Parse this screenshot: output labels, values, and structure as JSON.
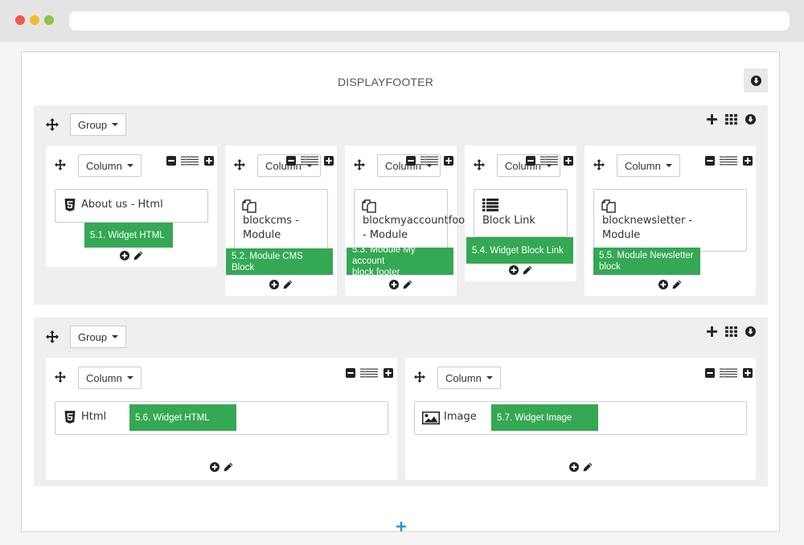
{
  "hook": {
    "title": "DISPLAYFOOTER"
  },
  "icons": {
    "move": "move-arrows-icon",
    "add": "plus-icon",
    "grid": "grid-icon",
    "arrow_down": "arrow-down-circle-icon",
    "minus": "minus-square-icon",
    "width": "width-lines-icon",
    "plus_square": "plus-square-icon",
    "html5": "html5-icon",
    "module": "module-copy-icon",
    "list": "list-icon",
    "image": "image-icon",
    "edit": "pencil-icon"
  },
  "colors": {
    "callout": "#34a853",
    "accent_plus": "#1a9ed4"
  },
  "groups": [
    {
      "label": "Group",
      "columns": [
        {
          "label": "Column",
          "widget": {
            "title": "About us - Html",
            "icon": "html5-icon"
          },
          "note": "5.1. Widget HTML"
        },
        {
          "label": "Column",
          "widget": {
            "title": "blockcms -",
            "subtitle": "Module",
            "icon": "module-copy-icon"
          },
          "note": "5.2. Module CMS Block"
        },
        {
          "label": "Column",
          "widget": {
            "title": "blockmyaccountfoo",
            "subtitle": "- Module",
            "icon": "module-copy-icon"
          },
          "note": "5.3. Module My account",
          "note2": "block footer"
        },
        {
          "label": "Column",
          "widget": {
            "title": "Block Link",
            "icon": "list-icon"
          },
          "note": "5.4. Widget Block Link"
        },
        {
          "label": "Column",
          "widget": {
            "title": "blocknewsletter -",
            "subtitle": "Module",
            "icon": "module-copy-icon"
          },
          "note": "5.5. Module Newsletter",
          "note2": "block"
        }
      ]
    },
    {
      "label": "Group",
      "columns": [
        {
          "label": "Column",
          "widget": {
            "title": "Html",
            "icon": "html5-icon"
          },
          "note": "5.6. Widget HTML"
        },
        {
          "label": "Column",
          "widget": {
            "title": "Image",
            "icon": "image-icon"
          },
          "note": "5.7. Widget Image"
        }
      ]
    }
  ]
}
